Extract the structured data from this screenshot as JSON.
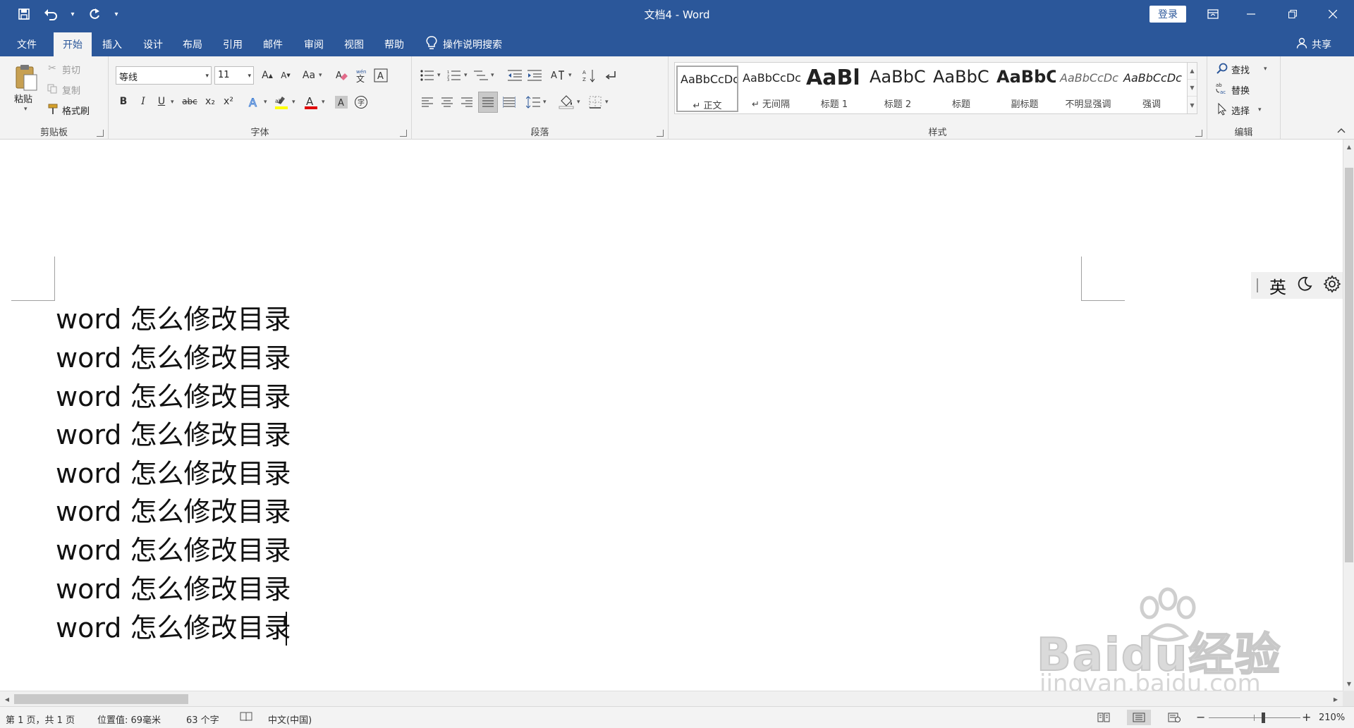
{
  "app": {
    "title": "文档4 - Word",
    "login_label": "登录"
  },
  "ribbon_tabs": [
    {
      "label": "文件",
      "active": false
    },
    {
      "label": "开始",
      "active": true
    },
    {
      "label": "插入",
      "active": false
    },
    {
      "label": "设计",
      "active": false
    },
    {
      "label": "布局",
      "active": false
    },
    {
      "label": "引用",
      "active": false
    },
    {
      "label": "邮件",
      "active": false
    },
    {
      "label": "审阅",
      "active": false
    },
    {
      "label": "视图",
      "active": false
    },
    {
      "label": "帮助",
      "active": false
    }
  ],
  "tell_me": "操作说明搜索",
  "share_label": "共享",
  "clipboard": {
    "group_label": "剪贴板",
    "paste": "粘贴",
    "cut": "剪切",
    "copy": "复制",
    "format_painter": "格式刷"
  },
  "font": {
    "group_label": "字体",
    "font_name": "等线",
    "font_size": "11",
    "case_label": "Aa",
    "bold": "B",
    "italic": "I",
    "underline": "U",
    "strike": "abc",
    "subscript": "x₂",
    "superscript": "x²"
  },
  "paragraph": {
    "group_label": "段落"
  },
  "styles": {
    "group_label": "样式",
    "items": [
      {
        "preview": "AaBbCcDc",
        "name": "↵ 正文"
      },
      {
        "preview": "AaBbCcDc",
        "name": "↵ 无间隔"
      },
      {
        "preview": "AaBl",
        "name": "标题 1"
      },
      {
        "preview": "AaBbC",
        "name": "标题 2"
      },
      {
        "preview": "AaBbC",
        "name": "标题"
      },
      {
        "preview": "AaBbC",
        "name": "副标题"
      },
      {
        "preview": "AaBbCcDc",
        "name": "不明显强调"
      },
      {
        "preview": "AaBbCcDc",
        "name": "强调"
      }
    ]
  },
  "editing": {
    "group_label": "编辑",
    "find": "查找",
    "replace": "替换",
    "select": "选择"
  },
  "document": {
    "lines": [
      "word 怎么修改目录",
      "word 怎么修改目录",
      "word 怎么修改目录",
      "word 怎么修改目录",
      "word 怎么修改目录",
      "word 怎么修改目录",
      "word 怎么修改目录",
      "word 怎么修改目录",
      "word 怎么修改目录"
    ]
  },
  "ime": {
    "mode": "英"
  },
  "watermark": {
    "brand": "Baidu经验",
    "url": "jingyan.baidu.com"
  },
  "status": {
    "page": "第 1 页，共 1 页",
    "position": "位置值: 69毫米",
    "words": "63 个字",
    "language": "中文(中国)",
    "zoom": "210%",
    "zoom_minus": "−",
    "zoom_plus": "+"
  },
  "colors": {
    "brand_blue": "#2b579a",
    "ribbon_bg": "#f3f3f3",
    "highlight_yellow": "#ffff00",
    "font_color_red": "#e00000"
  }
}
